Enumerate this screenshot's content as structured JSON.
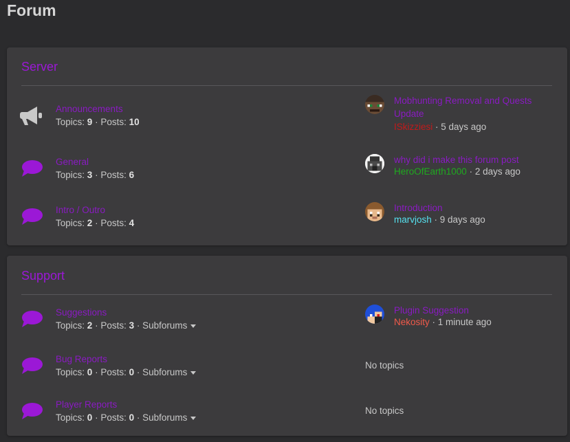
{
  "page": {
    "title": "Forum"
  },
  "colors": {
    "accent": "#9b18d6",
    "link": "#8a1bc2",
    "background": "#2b2b2d",
    "panel": "#3c3b3d",
    "user_red": "#c21a1a",
    "user_green": "#1faa1f",
    "user_cyan": "#55e0ee",
    "user_salmon": "#f05a4a"
  },
  "sections": [
    {
      "title": "Server",
      "forums": [
        {
          "icon": "megaphone-icon",
          "name": "Announcements",
          "topics_label": "Topics:",
          "topics": "9",
          "posts_label": "Posts:",
          "posts": "10",
          "latest": {
            "title": "Mobhunting Removal and Quests Update",
            "user": "ISkizziesi",
            "time": "5 days ago"
          }
        },
        {
          "icon": "speech-bubble-icon",
          "name": "General",
          "topics_label": "Topics:",
          "topics": "3",
          "posts_label": "Posts:",
          "posts": "6",
          "latest": {
            "title": "why did i make this forum post",
            "user": "HeroOfEarth1000",
            "time": "2 days ago"
          }
        },
        {
          "icon": "speech-bubble-icon",
          "name": "Intro / Outro",
          "topics_label": "Topics:",
          "topics": "2",
          "posts_label": "Posts:",
          "posts": "4",
          "latest": {
            "title": "Introduction",
            "user": "marvjosh",
            "time": "9 days ago"
          }
        }
      ]
    },
    {
      "title": "Support",
      "forums": [
        {
          "icon": "speech-bubble-icon",
          "name": "Suggestions",
          "topics_label": "Topics:",
          "topics": "2",
          "posts_label": "Posts:",
          "posts": "3",
          "subforums": "Subforums",
          "latest": {
            "title": "Plugin Suggestion",
            "user": "Nekosity",
            "time": "1 minute ago"
          }
        },
        {
          "icon": "speech-bubble-icon",
          "name": "Bug Reports",
          "topics_label": "Topics:",
          "topics": "0",
          "posts_label": "Posts:",
          "posts": "0",
          "subforums": "Subforums",
          "no_topics": "No topics"
        },
        {
          "icon": "speech-bubble-icon",
          "name": "Player Reports",
          "topics_label": "Topics:",
          "topics": "0",
          "posts_label": "Posts:",
          "posts": "0",
          "subforums": "Subforums",
          "no_topics": "No topics"
        }
      ]
    }
  ],
  "separator": " · "
}
